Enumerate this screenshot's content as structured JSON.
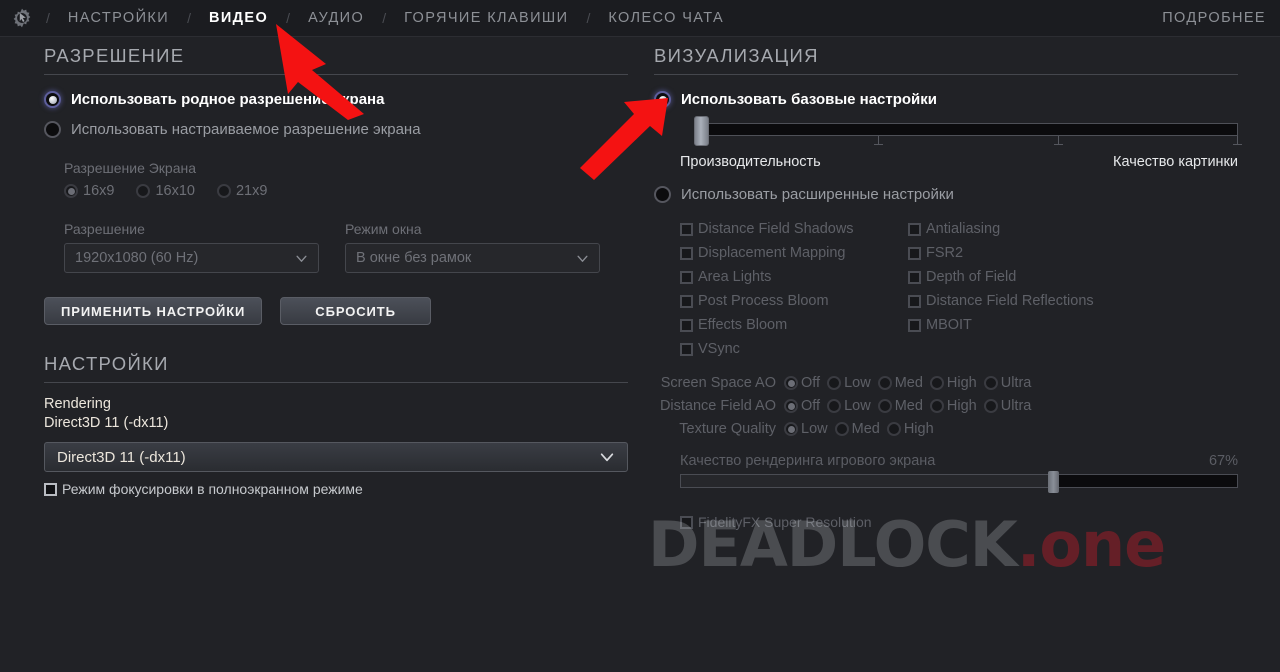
{
  "topbar": {
    "gear_icon": "gear-cursor-icon",
    "separator": "/",
    "items": [
      {
        "label": "НАСТРОЙКИ",
        "active": false
      },
      {
        "label": "ВИДЕО",
        "active": true
      },
      {
        "label": "АУДИО",
        "active": false
      },
      {
        "label": "ГОРЯЧИЕ КЛАВИШИ",
        "active": false
      },
      {
        "label": "КОЛЕСО ЧАТА",
        "active": false
      }
    ],
    "more_label": "ПОДРОБНЕЕ"
  },
  "left": {
    "section_title": "РАЗРЕШЕНИЕ",
    "radio_native": "Использовать родное разрешение экрана",
    "radio_custom": "Использовать настраиваемое разрешение экрана",
    "aspect_caption": "Разрешение Экрана",
    "aspect_options": [
      "16x9",
      "16x10",
      "21x9"
    ],
    "resolution_caption": "Разрешение",
    "resolution_value": "1920x1080 (60 Hz)",
    "window_caption": "Режим окна",
    "window_value": "В окне без рамок",
    "apply_button": "ПРИМЕНИТЬ НАСТРОЙКИ",
    "reset_button": "СБРОСИТЬ",
    "settings_title": "НАСТРОЙКИ",
    "rendering_label": "Rendering",
    "rendering_value": "Direct3D 11 (-dx11)",
    "rendering_select": "Direct3D 11 (-dx11)",
    "focus_mode_label": "Режим фокусировки в полноэкранном режиме"
  },
  "right": {
    "section_title": "ВИЗУАЛИЗАЦИЯ",
    "radio_basic": "Использовать базовые настройки",
    "slider_left_label": "Производительность",
    "slider_right_label": "Качество картинки",
    "radio_advanced": "Использовать расширенные настройки",
    "advanced_options": [
      "Distance Field Shadows",
      "Antialiasing",
      "Displacement Mapping",
      "FSR2",
      "Area Lights",
      "Depth of Field",
      "Post Process Bloom",
      "Distance Field Reflections",
      "Effects Bloom",
      "MBOIT",
      "VSync",
      ""
    ],
    "quality_rows": [
      {
        "name": "Screen Space AO",
        "options": [
          "Off",
          "Low",
          "Med",
          "High",
          "Ultra"
        ],
        "selected": 0
      },
      {
        "name": "Distance Field AO",
        "options": [
          "Off",
          "Low",
          "Med",
          "High",
          "Ultra"
        ],
        "selected": 0
      },
      {
        "name": "Texture Quality",
        "options": [
          "Low",
          "Med",
          "High"
        ],
        "selected": 0
      }
    ],
    "render_quality_label": "Качество рендеринга игрового экрана",
    "render_quality_value": "67%",
    "render_quality_percent": 67,
    "fsr_label": "FidelityFX Super Resolution"
  },
  "watermark": {
    "part_a": "DEADLOCK",
    "part_b": ".one"
  },
  "colors": {
    "background": "#212226",
    "topbar": "#1b1c20",
    "accent_selected": "#5d5e9c",
    "text_primary": "#ffffff",
    "text_muted": "#8d9096",
    "text_disabled": "#5e6067",
    "arrow_red": "#f41212",
    "watermark_red": "#c41c28"
  },
  "annotations": {
    "arrow_1": "arrow-pointing-to-video-tab",
    "arrow_2": "arrow-pointing-to-basic-settings-radio"
  }
}
